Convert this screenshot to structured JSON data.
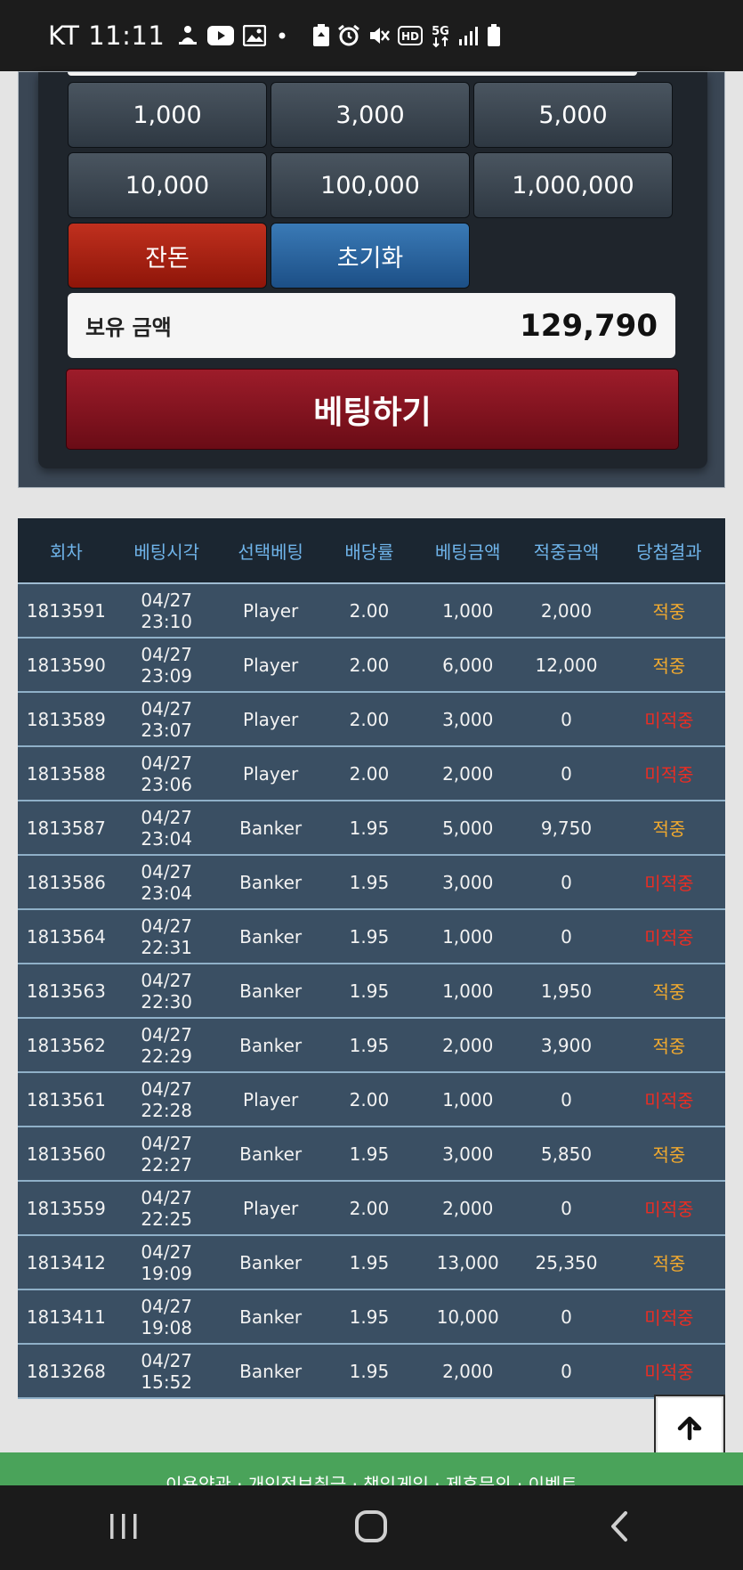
{
  "status_bar": {
    "time": "KT 11:11",
    "icons": [
      "notification-icon",
      "youtube-icon",
      "gallery-icon",
      "dot-icon",
      "battery-saver-icon",
      "alarm-icon",
      "mute-icon",
      "hd-icon",
      "5g-icon",
      "signal-icon",
      "battery-icon"
    ],
    "hd_label": "HD",
    "net_label": "5G"
  },
  "bet_panel": {
    "amounts": [
      "1,000",
      "3,000",
      "5,000",
      "10,000",
      "100,000",
      "1,000,000"
    ],
    "change_label": "잔돈",
    "reset_label": "초기화",
    "balance_label": "보유 금액",
    "balance_value": "129,790",
    "bet_button_label": "베팅하기"
  },
  "history": {
    "headers": [
      "회차",
      "베팅시각",
      "선택베팅",
      "배당률",
      "베팅금액",
      "적중금액",
      "당첨결과"
    ],
    "rows": [
      {
        "round": "1813591",
        "time": "04/27 23:10",
        "choice": "Player",
        "odds": "2.00",
        "bet": "1,000",
        "win_amount": "2,000",
        "result": "적중",
        "hit": true
      },
      {
        "round": "1813590",
        "time": "04/27 23:09",
        "choice": "Player",
        "odds": "2.00",
        "bet": "6,000",
        "win_amount": "12,000",
        "result": "적중",
        "hit": true
      },
      {
        "round": "1813589",
        "time": "04/27 23:07",
        "choice": "Player",
        "odds": "2.00",
        "bet": "3,000",
        "win_amount": "0",
        "result": "미적중",
        "hit": false
      },
      {
        "round": "1813588",
        "time": "04/27 23:06",
        "choice": "Player",
        "odds": "2.00",
        "bet": "2,000",
        "win_amount": "0",
        "result": "미적중",
        "hit": false
      },
      {
        "round": "1813587",
        "time": "04/27 23:04",
        "choice": "Banker",
        "odds": "1.95",
        "bet": "5,000",
        "win_amount": "9,750",
        "result": "적중",
        "hit": true
      },
      {
        "round": "1813586",
        "time": "04/27 23:04",
        "choice": "Banker",
        "odds": "1.95",
        "bet": "3,000",
        "win_amount": "0",
        "result": "미적중",
        "hit": false
      },
      {
        "round": "1813564",
        "time": "04/27 22:31",
        "choice": "Banker",
        "odds": "1.95",
        "bet": "1,000",
        "win_amount": "0",
        "result": "미적중",
        "hit": false
      },
      {
        "round": "1813563",
        "time": "04/27 22:30",
        "choice": "Banker",
        "odds": "1.95",
        "bet": "1,000",
        "win_amount": "1,950",
        "result": "적중",
        "hit": true
      },
      {
        "round": "1813562",
        "time": "04/27 22:29",
        "choice": "Banker",
        "odds": "1.95",
        "bet": "2,000",
        "win_amount": "3,900",
        "result": "적중",
        "hit": true
      },
      {
        "round": "1813561",
        "time": "04/27 22:28",
        "choice": "Player",
        "odds": "2.00",
        "bet": "1,000",
        "win_amount": "0",
        "result": "미적중",
        "hit": false
      },
      {
        "round": "1813560",
        "time": "04/27 22:27",
        "choice": "Banker",
        "odds": "1.95",
        "bet": "3,000",
        "win_amount": "5,850",
        "result": "적중",
        "hit": true
      },
      {
        "round": "1813559",
        "time": "04/27 22:25",
        "choice": "Player",
        "odds": "2.00",
        "bet": "2,000",
        "win_amount": "0",
        "result": "미적중",
        "hit": false
      },
      {
        "round": "1813412",
        "time": "04/27 19:09",
        "choice": "Banker",
        "odds": "1.95",
        "bet": "13,000",
        "win_amount": "25,350",
        "result": "적중",
        "hit": true
      },
      {
        "round": "1813411",
        "time": "04/27 19:08",
        "choice": "Banker",
        "odds": "1.95",
        "bet": "10,000",
        "win_amount": "0",
        "result": "미적중",
        "hit": false
      },
      {
        "round": "1813268",
        "time": "04/27 15:52",
        "choice": "Banker",
        "odds": "1.95",
        "bet": "2,000",
        "win_amount": "0",
        "result": "미적중",
        "hit": false
      }
    ]
  },
  "footer": {
    "links_text": "이용약관 · 개인정보취급 · 책임게임 · 제휴문의 · 이벤트"
  },
  "colors": {
    "win": "#f0a92f",
    "lose": "#ea2d23",
    "header_text": "#6fb4ea",
    "footer_bar": "#4aa35a"
  },
  "nav_bar": {
    "icons": [
      "recent-apps-icon",
      "home-icon",
      "back-icon"
    ]
  }
}
